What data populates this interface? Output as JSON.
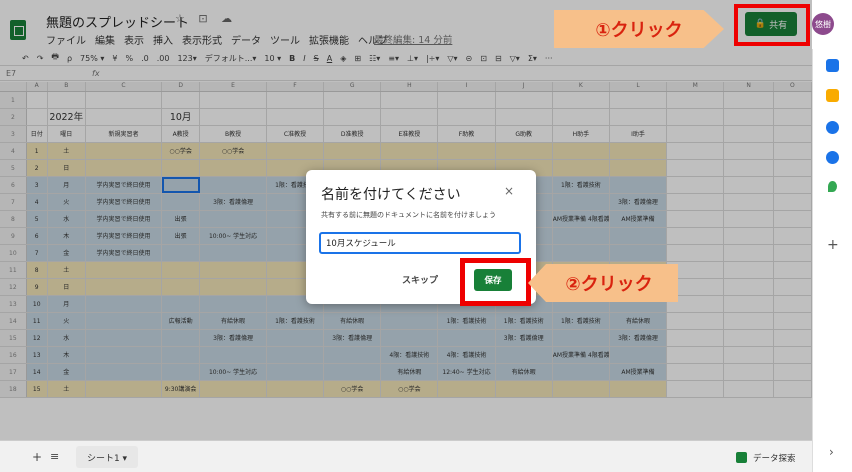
{
  "app": {
    "title": "無題のスプレッドシート",
    "title_icons": "☆ ⊡ ☁",
    "menu": [
      "ファイル",
      "編集",
      "表示",
      "挿入",
      "表示形式",
      "データ",
      "ツール",
      "拡張機能",
      "ヘルプ"
    ],
    "last_edit": "最終編集: 14 分前",
    "share_label": "共有",
    "avatar_initials": "悠樹"
  },
  "toolbar": {
    "items": [
      "↶",
      "↷",
      "🖶",
      "⍴",
      "75% ▾",
      "¥",
      "%",
      ".0",
      ".00",
      "123▾",
      "デフォルト...▾",
      "10 ▾",
      "B",
      "I",
      "S",
      "A",
      "◈",
      "⊞",
      "☷▾",
      "≡▾",
      "⊥▾",
      "|÷▾",
      "▽▾",
      "⊝",
      "⊡",
      "⊟",
      "▽▾",
      "Σ▾",
      "···"
    ]
  },
  "formula_bar": {
    "cell_ref": "E7",
    "fx": "fx"
  },
  "grid": {
    "column_letters": [
      "A",
      "B",
      "C",
      "D",
      "E",
      "F",
      "G",
      "H",
      "I",
      "J",
      "K",
      "L",
      "M",
      "N",
      "O"
    ],
    "row_numbers": [
      "1",
      "2",
      "3",
      "4",
      "5",
      "6",
      "7",
      "8",
      "9",
      "10",
      "11",
      "12",
      "13",
      "14",
      "15",
      "16",
      "17",
      "18",
      "19",
      "20"
    ],
    "header_year": "2022年",
    "header_month": "10月",
    "headers": [
      "日付",
      "曜日",
      "新規実習者",
      "A教授",
      "B教授",
      "C准教授",
      "D准教授",
      "E准教授",
      "F助教",
      "G助教",
      "H助手",
      "I助手"
    ],
    "rows": [
      [
        "1",
        "土",
        "",
        "○○学会",
        "○○学会",
        "",
        "",
        "",
        "",
        "",
        "",
        ""
      ],
      [
        "2",
        "日",
        "",
        "",
        "",
        "",
        "",
        "",
        "",
        "",
        "",
        ""
      ],
      [
        "3",
        "月",
        "学内実習で終日使用",
        "",
        "",
        "1限：看護技術",
        "",
        "",
        "",
        "",
        "1限：看護技術",
        ""
      ],
      [
        "4",
        "火",
        "学内実習で終日使用",
        "",
        "3限：看護倫理",
        "",
        "",
        "",
        "",
        "",
        "",
        "3限：看護倫理"
      ],
      [
        "5",
        "水",
        "学内実習で終日使用",
        "出張",
        "",
        "",
        "",
        "",
        "",
        "",
        "AM授業準備 4限看護技術",
        "AM授業準備"
      ],
      [
        "6",
        "木",
        "学内実習で終日使用",
        "出張",
        "10:00~ 学生対応",
        "",
        "",
        "",
        "",
        "",
        "",
        ""
      ],
      [
        "7",
        "金",
        "学内実習で終日使用",
        "",
        "",
        "",
        "",
        "",
        "",
        "",
        "",
        ""
      ],
      [
        "8",
        "土",
        "",
        "",
        "",
        "",
        "",
        "",
        "",
        "",
        "",
        ""
      ],
      [
        "9",
        "日",
        "",
        "",
        "",
        "",
        "",
        "",
        "",
        "",
        "",
        ""
      ],
      [
        "10",
        "月",
        "",
        "",
        "",
        "",
        "",
        "",
        "",
        "",
        "",
        ""
      ],
      [
        "11",
        "火",
        "",
        "広報活動",
        "有給休暇",
        "1限：看護技術",
        "有給休暇",
        "",
        "1限：看護技術",
        "1限：看護技術",
        "1限：看護技術",
        "有給休暇"
      ],
      [
        "12",
        "水",
        "",
        "",
        "3限：看護倫理",
        "",
        "3限：看護倫理",
        "",
        "",
        "3限：看護倫理",
        "",
        "3限：看護倫理"
      ],
      [
        "13",
        "木",
        "",
        "",
        "",
        "",
        "",
        "4限：看護技術",
        "4限：看護技術",
        "",
        "AM授業準備 4限看護技術",
        ""
      ],
      [
        "14",
        "金",
        "",
        "",
        "10:00~ 学生対応",
        "",
        "",
        "有給休暇",
        "12:40~ 学生対応",
        "有給休暇",
        "",
        "AM授業準備"
      ],
      [
        "15",
        "土",
        "",
        "9:30講演会",
        "",
        "",
        "○○学会",
        "○○学会",
        "",
        "",
        "",
        ""
      ]
    ]
  },
  "dialog": {
    "title": "名前を付けてください",
    "close": "×",
    "message": "共有する前に無題のドキュメントに名前を付けましょう",
    "input_value": "10月スケジュール",
    "skip_label": "スキップ",
    "save_label": "保存"
  },
  "annotations": {
    "step1": "①クリック",
    "step2": "②クリック"
  },
  "bottom": {
    "add": "+",
    "sheets_menu": "≡",
    "sheet_tab": "シート1 ▾",
    "explore": "データ探索"
  },
  "colors": {
    "green": "#188038",
    "highlight_red": "#e00000",
    "callout": "#f7c08a",
    "blue_row": "#c7d9e4",
    "yellow_row": "#f3e6b9",
    "pink_cell": "#f4cccc"
  }
}
